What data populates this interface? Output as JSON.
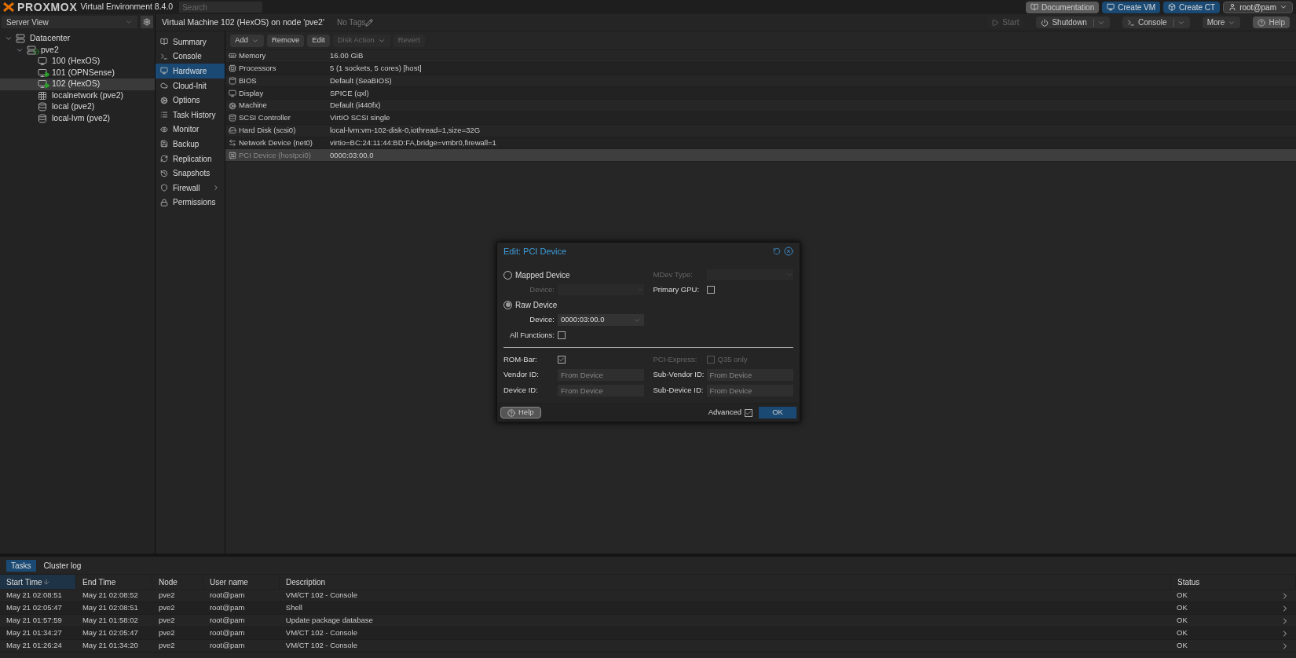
{
  "header": {
    "logo": "PROXMOX",
    "version": "Virtual Environment 8.4.0",
    "search": {
      "placeholder": "Search"
    },
    "buttons": [
      {
        "label": "Documentation",
        "kind": "docs"
      },
      {
        "label": "Create VM",
        "kind": "vm"
      },
      {
        "label": "Create CT",
        "kind": "ct"
      }
    ],
    "user": "root@pam"
  },
  "tree": {
    "view": "Server View",
    "items": [
      {
        "label": "Datacenter",
        "kind": "datacenter",
        "selected": false,
        "expanded": true,
        "children": [
          {
            "label": "pve2",
            "kind": "node",
            "selected": false,
            "expanded": true,
            "children": [
              {
                "label": "100 (HexOS)",
                "kind": "vm",
                "running": false,
                "selected": false
              },
              {
                "label": "101 (OPNSense)",
                "kind": "vm",
                "running": true,
                "selected": false
              },
              {
                "label": "102 (HexOS)",
                "kind": "vm",
                "running": true,
                "selected": true
              },
              {
                "label": "localnetwork (pve2)",
                "kind": "sdn",
                "selected": false
              },
              {
                "label": "local (pve2)",
                "kind": "storage",
                "selected": false
              },
              {
                "label": "local-lvm (pve2)",
                "kind": "storage",
                "selected": false
              }
            ]
          }
        ]
      }
    ]
  },
  "vm": {
    "title": "Virtual Machine 102 (HexOS) on node 'pve2'",
    "tags": "No Tags",
    "actions": [
      {
        "label": "Start",
        "kind": "start",
        "disabled": true,
        "split": false
      },
      {
        "label": "Shutdown",
        "kind": "shutdown",
        "disabled": false,
        "split": true
      },
      {
        "label": "Console",
        "kind": "console",
        "disabled": false,
        "split": true
      },
      {
        "label": "More",
        "kind": "more",
        "disabled": false,
        "split": false
      },
      {
        "label": "Help",
        "kind": "help",
        "disabled": false,
        "split": false
      }
    ]
  },
  "nav": [
    {
      "label": "Summary",
      "kind": "summary",
      "selected": false,
      "submenu": false
    },
    {
      "label": "Console",
      "kind": "console",
      "selected": false,
      "submenu": false
    },
    {
      "label": "Hardware",
      "kind": "hardware",
      "selected": true,
      "submenu": false
    },
    {
      "label": "Cloud-Init",
      "kind": "cloud",
      "selected": false,
      "submenu": false
    },
    {
      "label": "Options",
      "kind": "options",
      "selected": false,
      "submenu": false
    },
    {
      "label": "Task History",
      "kind": "tasks",
      "selected": false,
      "submenu": false
    },
    {
      "label": "Monitor",
      "kind": "monitor",
      "selected": false,
      "submenu": false
    },
    {
      "label": "Backup",
      "kind": "backup",
      "selected": false,
      "submenu": false
    },
    {
      "label": "Replication",
      "kind": "replication",
      "selected": false,
      "submenu": false
    },
    {
      "label": "Snapshots",
      "kind": "snapshots",
      "selected": false,
      "submenu": false
    },
    {
      "label": "Firewall",
      "kind": "firewall",
      "selected": false,
      "submenu": true
    },
    {
      "label": "Permissions",
      "kind": "permissions",
      "selected": false,
      "submenu": false
    }
  ],
  "hardware": {
    "toolbar": [
      {
        "label": "Add",
        "dropdown": true,
        "disabled": false
      },
      {
        "label": "Remove",
        "dropdown": false,
        "disabled": false
      },
      {
        "label": "Edit",
        "dropdown": false,
        "disabled": false
      },
      {
        "label": "Disk Action",
        "dropdown": true,
        "disabled": true
      },
      {
        "label": "Revert",
        "dropdown": false,
        "disabled": true
      }
    ],
    "rows": [
      {
        "name": "Memory",
        "value": "16.00 GiB",
        "kind": "memory",
        "selected": false
      },
      {
        "name": "Processors",
        "value": "5 (1 sockets, 5 cores) [host]",
        "kind": "cpu",
        "selected": false
      },
      {
        "name": "BIOS",
        "value": "Default (SeaBIOS)",
        "kind": "bios",
        "selected": false
      },
      {
        "name": "Display",
        "value": "SPICE (qxl)",
        "kind": "display",
        "selected": false
      },
      {
        "name": "Machine",
        "value": "Default (i440fx)",
        "kind": "machine",
        "selected": false
      },
      {
        "name": "SCSI Controller",
        "value": "VirtIO SCSI single",
        "kind": "scsi",
        "selected": false
      },
      {
        "name": "Hard Disk (scsi0)",
        "value": "local-lvm:vm-102-disk-0,iothread=1,size=32G",
        "kind": "disk",
        "selected": false
      },
      {
        "name": "Network Device (net0)",
        "value": "virtio=BC:24:11:44:BD:FA,bridge=vmbr0,firewall=1",
        "kind": "network",
        "selected": false
      },
      {
        "name": "PCI Device (hostpci0)",
        "value": "0000:03:00.0",
        "kind": "pci",
        "selected": true
      }
    ]
  },
  "dialog": {
    "title": "Edit: PCI Device",
    "mapped": {
      "label": "Mapped Device",
      "selected": false,
      "device_label": "Device:"
    },
    "mdev": {
      "label": "MDev Type:",
      "disabled": true
    },
    "primary_gpu": {
      "label": "Primary GPU:",
      "checked": false
    },
    "raw": {
      "label": "Raw Device",
      "selected": true,
      "device_label": "Device:",
      "device_value": "0000:03:00.0"
    },
    "all_functions": {
      "label": "All Functions:",
      "checked": false
    },
    "rom_bar": {
      "label": "ROM-Bar:",
      "checked": true
    },
    "pci_express": {
      "label": "PCI-Express:",
      "option": "Q35 only",
      "checked": false,
      "disabled": true
    },
    "ids": [
      {
        "label": "Vendor ID:",
        "placeholder": "From Device"
      },
      {
        "label": "Sub-Vendor ID:",
        "placeholder": "From Device"
      },
      {
        "label": "Device ID:",
        "placeholder": "From Device"
      },
      {
        "label": "Sub-Device ID:",
        "placeholder": "From Device"
      }
    ],
    "help": "Help",
    "advanced": {
      "label": "Advanced",
      "checked": true
    },
    "ok": "OK"
  },
  "tasks": {
    "tabs": [
      {
        "label": "Tasks",
        "selected": true
      },
      {
        "label": "Cluster log",
        "selected": false
      }
    ],
    "columns": [
      "Start Time",
      "End Time",
      "Node",
      "User name",
      "Description",
      "Status"
    ],
    "rows": [
      [
        "May 21 02:08:51",
        "May 21 02:08:52",
        "pve2",
        "root@pam",
        "VM/CT 102 - Console",
        "OK"
      ],
      [
        "May 21 02:05:47",
        "May 21 02:08:51",
        "pve2",
        "root@pam",
        "Shell",
        "OK"
      ],
      [
        "May 21 01:57:59",
        "May 21 01:58:02",
        "pve2",
        "root@pam",
        "Update package database",
        "OK"
      ],
      [
        "May 21 01:34:27",
        "May 21 02:05:47",
        "pve2",
        "root@pam",
        "VM/CT 102 - Console",
        "OK"
      ],
      [
        "May 21 01:26:24",
        "May 21 01:34:20",
        "pve2",
        "root@pam",
        "VM/CT 102 - Console",
        "OK"
      ]
    ]
  }
}
